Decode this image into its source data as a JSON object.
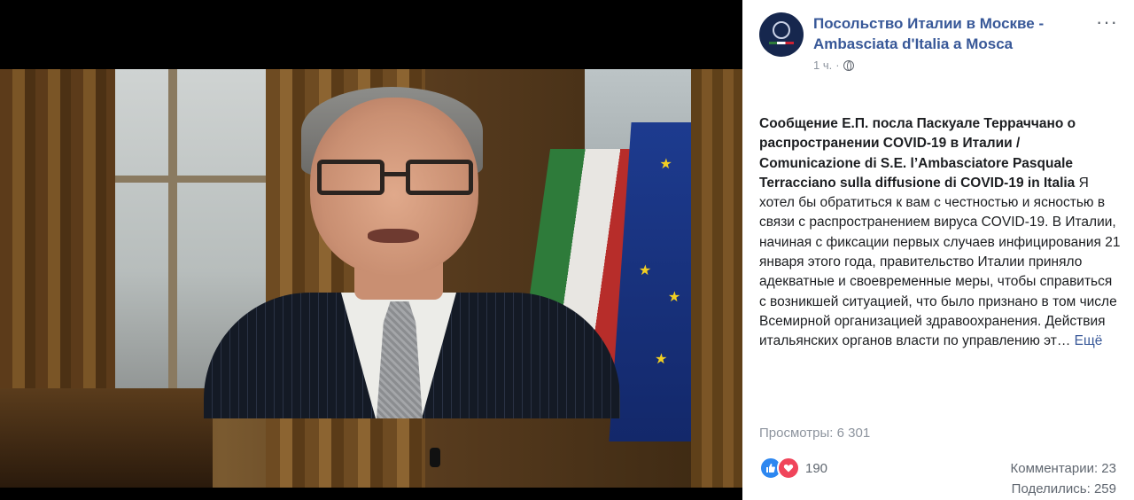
{
  "post": {
    "author_line1": "Посольство Италии в Москве -",
    "author_line2": "Ambasciata d'Italia a Mosca",
    "time": "1 ч.",
    "dot": "·",
    "title": "Сообщение Е.П. посла Паскуале Терраччано о распространении COVID-19 в Италии / Comunicazione di S.E. l’Ambasciatore Pasquale Terracciano sulla diffusione di COVID-19 in Italia",
    "body": "Я хотел бы обратиться к вам с честностью и ясностью в связи с распространением вируса COVID-19. В Италии, начиная с фиксации первых случаев инфицирования 21 января этого года, правительство Италии приняло адекватные и своевременные меры, чтобы справиться с возникшей ситуацией, что было признано в том числе Всемирной организацией здравоохранения. Действия итальянских органов власти по управлению эт…",
    "more_label": "Ещё",
    "menu_label": "···"
  },
  "stats": {
    "views": "Просмотры: 6 301",
    "reactions": "190",
    "comments": "Комментарии: 23",
    "shares": "Поделились: 259"
  },
  "icons": {
    "avatar": "embassy-emblem",
    "privacy": "globe-icon",
    "like": "like-icon",
    "love": "love-icon"
  },
  "colors": {
    "link": "#385898",
    "text": "#1c1e21",
    "muted": "#8d949e",
    "like": "#2d87f0",
    "love": "#f0445a"
  }
}
